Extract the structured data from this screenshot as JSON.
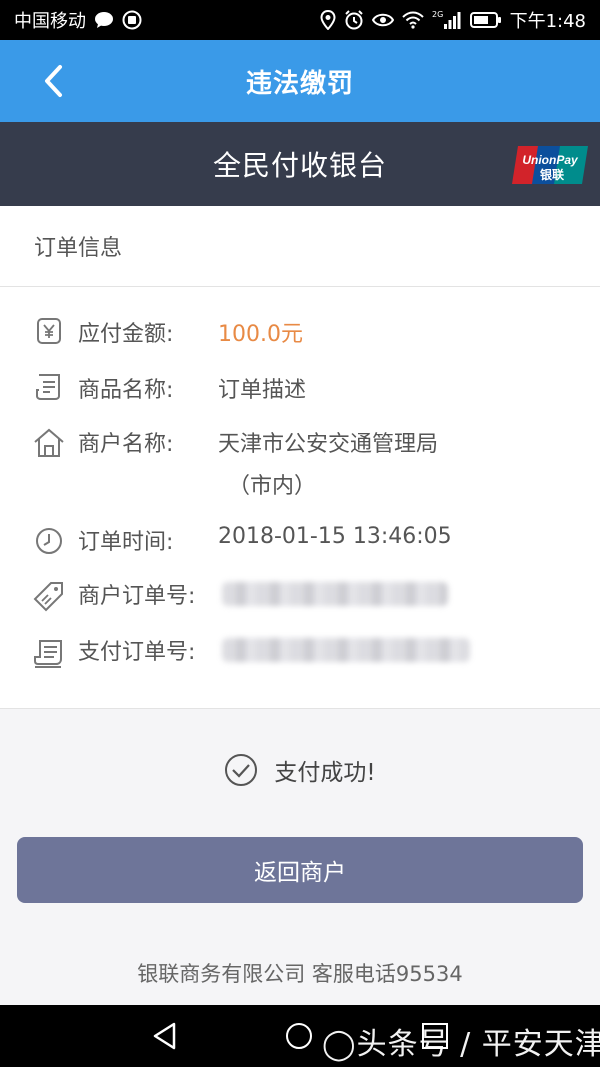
{
  "status_bar": {
    "carrier": "中国移动",
    "network": "2G",
    "time": "下午1:48"
  },
  "nav": {
    "title": "违法缴罚"
  },
  "cashier": {
    "title": "全民付收银台",
    "logo_text_top": "UnionPay",
    "logo_text_bottom": "银联"
  },
  "order": {
    "header": "订单信息",
    "rows": [
      {
        "label": "应付金额:",
        "value": "100.0元",
        "icon": "yen-icon"
      },
      {
        "label": "商品名称:",
        "value": "订单描述",
        "icon": "document-icon"
      },
      {
        "label": "商户名称:",
        "value": "天津市公安交通管理局",
        "value2": "（市内）",
        "icon": "home-icon"
      },
      {
        "label": "订单时间:",
        "value": "2018-01-15 13:46:05",
        "icon": "clock-icon"
      },
      {
        "label": "商户订单号:",
        "icon": "tag-icon"
      },
      {
        "label": "支付订单号:",
        "icon": "receipt-icon"
      }
    ]
  },
  "status": {
    "text": "支付成功!"
  },
  "button": {
    "label": "返回商户"
  },
  "footer": {
    "text": "银联商务有限公司 客服电话95534"
  },
  "watermark": {
    "text": "◯头条号 / 平安天津"
  },
  "colors": {
    "nav": "#3a9ae8",
    "cashier": "#363c4c",
    "amount": "#e88a45",
    "button": "#6e7599"
  }
}
